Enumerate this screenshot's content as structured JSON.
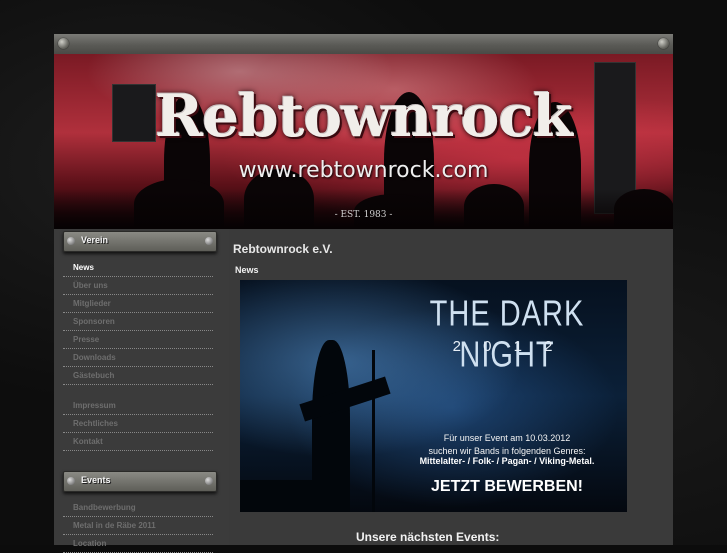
{
  "header": {
    "logo_text": "Rebtownrock",
    "url": "www.rebtownrock.com",
    "established": "- EST. 1983 -"
  },
  "sidebar": {
    "section1": {
      "title": "Verein",
      "items": [
        {
          "label": "News",
          "active": true
        },
        {
          "label": "Über uns"
        },
        {
          "label": "Mitglieder"
        },
        {
          "label": "Sponsoren"
        },
        {
          "label": "Presse"
        },
        {
          "label": "Downloads"
        },
        {
          "label": "Gästebuch"
        }
      ],
      "items_b": [
        {
          "label": "Impressum"
        },
        {
          "label": "Rechtliches"
        },
        {
          "label": "Kontakt"
        }
      ]
    },
    "section2": {
      "title": "Events",
      "items": [
        {
          "label": "Bandbewerbung"
        },
        {
          "label": "Metal in de Räbe 2011"
        },
        {
          "label": "Location"
        }
      ]
    }
  },
  "main": {
    "site_title": "Rebtownrock e.V.",
    "news_label": "News",
    "banner": {
      "title": "THE DARK NIGHT",
      "year": "2 0 1 2",
      "line1": "Für unser Event am 10.03.2012",
      "line2": "suchen wir Bands in folgenden Genres:",
      "genres": "Mittelalter- / Folk- / Pagan- / Viking-Metal.",
      "cta": "JETZT BEWERBEN!"
    },
    "next_events": "Unsere nächsten Events:"
  },
  "colors": {
    "background": "#0c0c0c",
    "panel": "#3a3a3a",
    "active_link": "#ffffff",
    "inactive_link": "#6e6e6e"
  }
}
